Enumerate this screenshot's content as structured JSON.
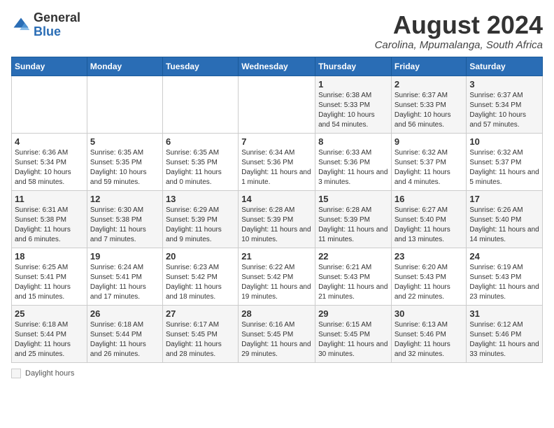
{
  "header": {
    "logo_general": "General",
    "logo_blue": "Blue",
    "title": "August 2024",
    "subtitle": "Carolina, Mpumalanga, South Africa"
  },
  "days_of_week": [
    "Sunday",
    "Monday",
    "Tuesday",
    "Wednesday",
    "Thursday",
    "Friday",
    "Saturday"
  ],
  "weeks": [
    [
      {
        "day": "",
        "info": ""
      },
      {
        "day": "",
        "info": ""
      },
      {
        "day": "",
        "info": ""
      },
      {
        "day": "",
        "info": ""
      },
      {
        "day": "1",
        "info": "Sunrise: 6:38 AM\nSunset: 5:33 PM\nDaylight: 10 hours and 54 minutes."
      },
      {
        "day": "2",
        "info": "Sunrise: 6:37 AM\nSunset: 5:33 PM\nDaylight: 10 hours and 56 minutes."
      },
      {
        "day": "3",
        "info": "Sunrise: 6:37 AM\nSunset: 5:34 PM\nDaylight: 10 hours and 57 minutes."
      }
    ],
    [
      {
        "day": "4",
        "info": "Sunrise: 6:36 AM\nSunset: 5:34 PM\nDaylight: 10 hours and 58 minutes."
      },
      {
        "day": "5",
        "info": "Sunrise: 6:35 AM\nSunset: 5:35 PM\nDaylight: 10 hours and 59 minutes."
      },
      {
        "day": "6",
        "info": "Sunrise: 6:35 AM\nSunset: 5:35 PM\nDaylight: 11 hours and 0 minutes."
      },
      {
        "day": "7",
        "info": "Sunrise: 6:34 AM\nSunset: 5:36 PM\nDaylight: 11 hours and 1 minute."
      },
      {
        "day": "8",
        "info": "Sunrise: 6:33 AM\nSunset: 5:36 PM\nDaylight: 11 hours and 3 minutes."
      },
      {
        "day": "9",
        "info": "Sunrise: 6:32 AM\nSunset: 5:37 PM\nDaylight: 11 hours and 4 minutes."
      },
      {
        "day": "10",
        "info": "Sunrise: 6:32 AM\nSunset: 5:37 PM\nDaylight: 11 hours and 5 minutes."
      }
    ],
    [
      {
        "day": "11",
        "info": "Sunrise: 6:31 AM\nSunset: 5:38 PM\nDaylight: 11 hours and 6 minutes."
      },
      {
        "day": "12",
        "info": "Sunrise: 6:30 AM\nSunset: 5:38 PM\nDaylight: 11 hours and 7 minutes."
      },
      {
        "day": "13",
        "info": "Sunrise: 6:29 AM\nSunset: 5:39 PM\nDaylight: 11 hours and 9 minutes."
      },
      {
        "day": "14",
        "info": "Sunrise: 6:28 AM\nSunset: 5:39 PM\nDaylight: 11 hours and 10 minutes."
      },
      {
        "day": "15",
        "info": "Sunrise: 6:28 AM\nSunset: 5:39 PM\nDaylight: 11 hours and 11 minutes."
      },
      {
        "day": "16",
        "info": "Sunrise: 6:27 AM\nSunset: 5:40 PM\nDaylight: 11 hours and 13 minutes."
      },
      {
        "day": "17",
        "info": "Sunrise: 6:26 AM\nSunset: 5:40 PM\nDaylight: 11 hours and 14 minutes."
      }
    ],
    [
      {
        "day": "18",
        "info": "Sunrise: 6:25 AM\nSunset: 5:41 PM\nDaylight: 11 hours and 15 minutes."
      },
      {
        "day": "19",
        "info": "Sunrise: 6:24 AM\nSunset: 5:41 PM\nDaylight: 11 hours and 17 minutes."
      },
      {
        "day": "20",
        "info": "Sunrise: 6:23 AM\nSunset: 5:42 PM\nDaylight: 11 hours and 18 minutes."
      },
      {
        "day": "21",
        "info": "Sunrise: 6:22 AM\nSunset: 5:42 PM\nDaylight: 11 hours and 19 minutes."
      },
      {
        "day": "22",
        "info": "Sunrise: 6:21 AM\nSunset: 5:43 PM\nDaylight: 11 hours and 21 minutes."
      },
      {
        "day": "23",
        "info": "Sunrise: 6:20 AM\nSunset: 5:43 PM\nDaylight: 11 hours and 22 minutes."
      },
      {
        "day": "24",
        "info": "Sunrise: 6:19 AM\nSunset: 5:43 PM\nDaylight: 11 hours and 23 minutes."
      }
    ],
    [
      {
        "day": "25",
        "info": "Sunrise: 6:18 AM\nSunset: 5:44 PM\nDaylight: 11 hours and 25 minutes."
      },
      {
        "day": "26",
        "info": "Sunrise: 6:18 AM\nSunset: 5:44 PM\nDaylight: 11 hours and 26 minutes."
      },
      {
        "day": "27",
        "info": "Sunrise: 6:17 AM\nSunset: 5:45 PM\nDaylight: 11 hours and 28 minutes."
      },
      {
        "day": "28",
        "info": "Sunrise: 6:16 AM\nSunset: 5:45 PM\nDaylight: 11 hours and 29 minutes."
      },
      {
        "day": "29",
        "info": "Sunrise: 6:15 AM\nSunset: 5:45 PM\nDaylight: 11 hours and 30 minutes."
      },
      {
        "day": "30",
        "info": "Sunrise: 6:13 AM\nSunset: 5:46 PM\nDaylight: 11 hours and 32 minutes."
      },
      {
        "day": "31",
        "info": "Sunrise: 6:12 AM\nSunset: 5:46 PM\nDaylight: 11 hours and 33 minutes."
      }
    ]
  ],
  "legend": {
    "label": "Daylight hours"
  }
}
